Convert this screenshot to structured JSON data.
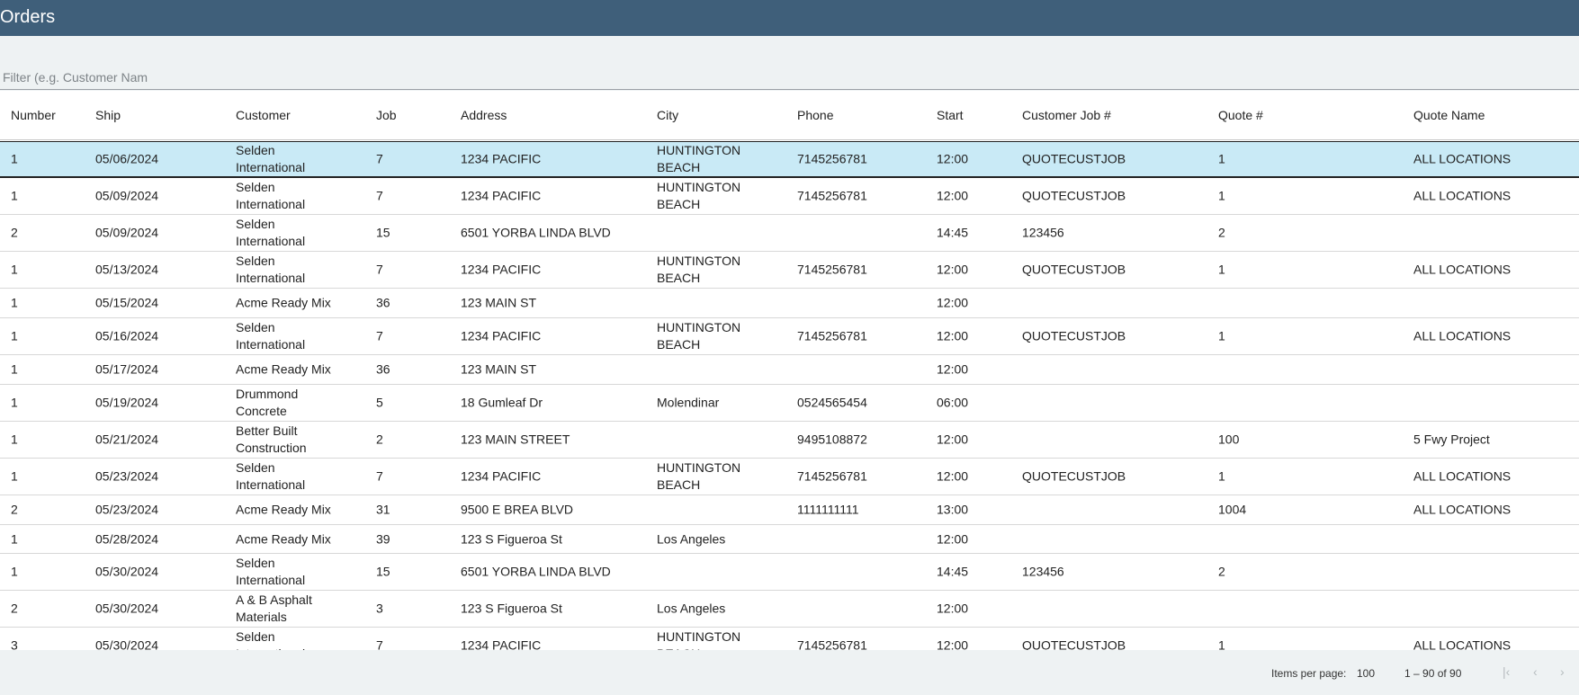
{
  "header": {
    "title": "Orders"
  },
  "filter": {
    "placeholder": "Filter (e.g. Customer Nam"
  },
  "columns": [
    "Number",
    "Ship",
    "Customer",
    "Job",
    "Address",
    "City",
    "Phone",
    "Start",
    "Customer Job #",
    "Quote #",
    "Quote Name"
  ],
  "rows": [
    [
      "1",
      "05/06/2024",
      "Selden\nInternational",
      "7",
      "1234 PACIFIC",
      "HUNTINGTON\nBEACH",
      "7145256781",
      "12:00",
      "QUOTECUSTJOB",
      "1",
      "ALL LOCATIONS"
    ],
    [
      "1",
      "05/09/2024",
      "Selden\nInternational",
      "7",
      "1234 PACIFIC",
      "HUNTINGTON\nBEACH",
      "7145256781",
      "12:00",
      "QUOTECUSTJOB",
      "1",
      "ALL LOCATIONS"
    ],
    [
      "2",
      "05/09/2024",
      "Selden\nInternational",
      "15",
      "6501 YORBA LINDA BLVD",
      "",
      "",
      "14:45",
      "123456",
      "2",
      ""
    ],
    [
      "1",
      "05/13/2024",
      "Selden\nInternational",
      "7",
      "1234 PACIFIC",
      "HUNTINGTON\nBEACH",
      "7145256781",
      "12:00",
      "QUOTECUSTJOB",
      "1",
      "ALL LOCATIONS"
    ],
    [
      "1",
      "05/15/2024",
      "Acme Ready Mix",
      "36",
      "123 MAIN ST",
      "",
      "",
      "12:00",
      "",
      "",
      ""
    ],
    [
      "1",
      "05/16/2024",
      "Selden\nInternational",
      "7",
      "1234 PACIFIC",
      "HUNTINGTON\nBEACH",
      "7145256781",
      "12:00",
      "QUOTECUSTJOB",
      "1",
      "ALL LOCATIONS"
    ],
    [
      "1",
      "05/17/2024",
      "Acme Ready Mix",
      "36",
      "123 MAIN ST",
      "",
      "",
      "12:00",
      "",
      "",
      ""
    ],
    [
      "1",
      "05/19/2024",
      "Drummond\nConcrete",
      "5",
      "18 Gumleaf Dr",
      "Molendinar",
      "0524565454",
      "06:00",
      "",
      "",
      ""
    ],
    [
      "1",
      "05/21/2024",
      "Better Built\nConstruction",
      "2",
      "123 MAIN STREET",
      "",
      "9495108872",
      "12:00",
      "",
      "100",
      "5 Fwy Project"
    ],
    [
      "1",
      "05/23/2024",
      "Selden\nInternational",
      "7",
      "1234 PACIFIC",
      "HUNTINGTON\nBEACH",
      "7145256781",
      "12:00",
      "QUOTECUSTJOB",
      "1",
      "ALL LOCATIONS"
    ],
    [
      "2",
      "05/23/2024",
      "Acme Ready Mix",
      "31",
      "9500 E BREA BLVD",
      "",
      "1111111111",
      "13:00",
      "",
      "1004",
      "ALL LOCATIONS"
    ],
    [
      "1",
      "05/28/2024",
      "Acme Ready Mix",
      "39",
      "123 S Figueroa St",
      "Los Angeles",
      "",
      "12:00",
      "",
      "",
      ""
    ],
    [
      "1",
      "05/30/2024",
      "Selden\nInternational",
      "15",
      "6501 YORBA LINDA BLVD",
      "",
      "",
      "14:45",
      "123456",
      "2",
      ""
    ],
    [
      "2",
      "05/30/2024",
      "A & B Asphalt\nMaterials",
      "3",
      "123 S Figueroa St",
      "Los Angeles",
      "",
      "12:00",
      "",
      "",
      ""
    ],
    [
      "3",
      "05/30/2024",
      "Selden\nInternational",
      "7",
      "1234 PACIFIC",
      "HUNTINGTON\nBEACH",
      "7145256781",
      "12:00",
      "QUOTECUSTJOB",
      "1",
      "ALL LOCATIONS"
    ]
  ],
  "paginator": {
    "items_per_page_label": "Items per page:",
    "items_per_page_value": "100",
    "range": "1 – 90 of 90",
    "first_icon": "first-page-icon",
    "prev_icon": "previous-page-icon",
    "next_icon": "next-page-icon"
  }
}
